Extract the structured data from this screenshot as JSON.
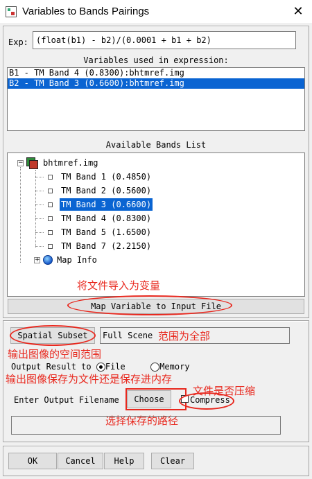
{
  "window": {
    "title": "Variables to Bands Pairings",
    "close_glyph": "✕"
  },
  "expression": {
    "label": "Exp:",
    "value": "(float(b1) - b2)/(0.0001 + b1 + b2)"
  },
  "variables": {
    "header": "Variables used in expression:",
    "items": [
      {
        "text": "B1 - TM Band 4 (0.8300):bhtmref.img",
        "selected": false
      },
      {
        "text": "B2 - TM Band 3 (0.6600):bhtmref.img",
        "selected": true
      }
    ]
  },
  "bands": {
    "header": "Available Bands List",
    "file": "bhtmref.img",
    "items": [
      {
        "label": "TM Band 1 (0.4850)"
      },
      {
        "label": "TM Band 2 (0.5600)"
      },
      {
        "label": "TM Band 3 (0.6600)"
      },
      {
        "label": "TM Band 4 (0.8300)"
      },
      {
        "label": "TM Band 5 (1.6500)"
      },
      {
        "label": "TM Band 7 (2.2150)"
      }
    ],
    "map_info": "Map Info"
  },
  "map_button": "Map Variable to Input File",
  "spatial_subset": {
    "button": "Spatial Subset",
    "value": "Full Scene"
  },
  "output": {
    "label": "Output Result to",
    "option_file": "File",
    "option_memory": "Memory",
    "filename_label": "Enter Output Filename",
    "choose": "Choose",
    "compress": "Compress",
    "filename_value": ""
  },
  "bottom_buttons": {
    "ok": "OK",
    "cancel": "Cancel",
    "help": "Help",
    "clear": "Clear"
  },
  "annotations": {
    "import_file": "将文件导入为变量",
    "full_scene": "范围为全部",
    "spatial_range": "输出图像的空间范围",
    "save_mode": "输出图像保存为文件还是保存进内存",
    "compress": "文件是否压缩",
    "path": "选择保存的路径"
  },
  "colors": {
    "selection": "#0a64d2",
    "annotation": "#e8281e"
  }
}
